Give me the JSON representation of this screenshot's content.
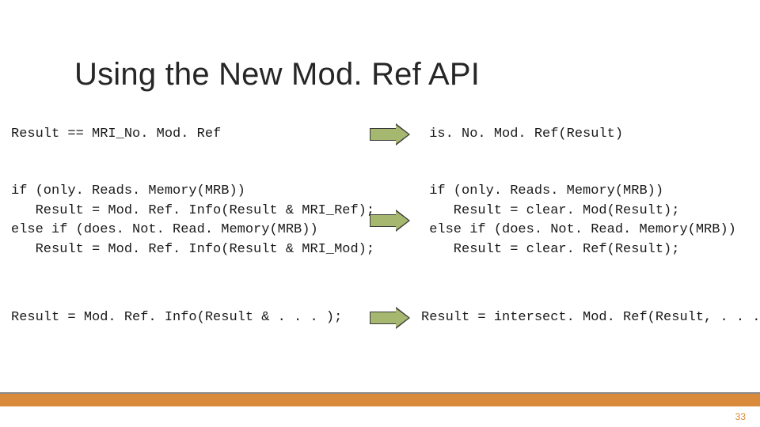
{
  "title": "Using the New Mod. Ref API",
  "rows": [
    {
      "left": "Result == MRI_No. Mod. Ref",
      "right": " is. No. Mod. Ref(Result)"
    },
    {
      "left": "if (only. Reads. Memory(MRB))\n   Result = Mod. Ref. Info(Result & MRI_Ref);\nelse if (does. Not. Read. Memory(MRB))\n   Result = Mod. Ref. Info(Result & MRI_Mod);",
      "right": " if (only. Reads. Memory(MRB))\n    Result = clear. Mod(Result);\n else if (does. Not. Read. Memory(MRB))\n    Result = clear. Ref(Result);"
    },
    {
      "left": "Result = Mod. Ref. Info(Result & . . . );",
      "right": "Result = intersect. Mod. Ref(Result, . . . );"
    }
  ],
  "page_number": "33",
  "colors": {
    "accent_bar": "#d98a3a",
    "arrow_fill": "#a6b86f"
  }
}
